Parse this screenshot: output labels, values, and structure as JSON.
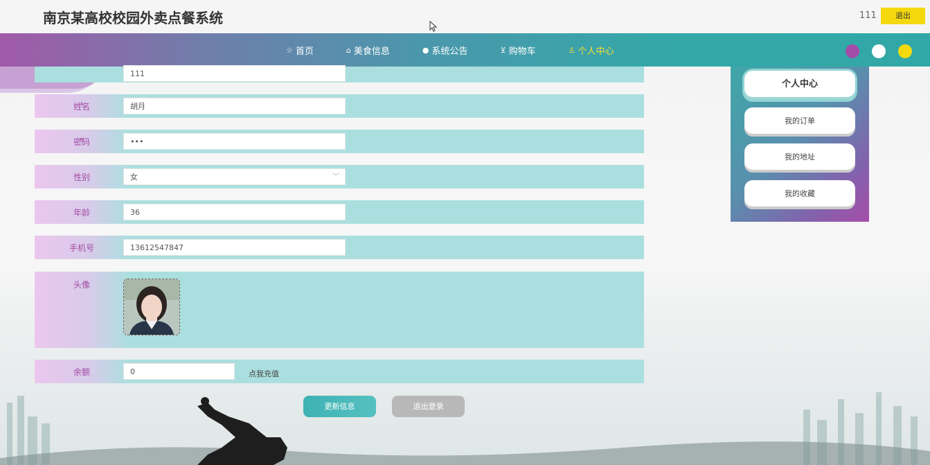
{
  "header": {
    "site_title": "南京某高校校园外卖点餐系统",
    "username": "111",
    "logout_label": "退出"
  },
  "nav": {
    "items": [
      {
        "icon": "star-icon",
        "glyph": "☆",
        "label": "首页"
      },
      {
        "icon": "bag-icon",
        "glyph": "⌂",
        "label": "美食信息"
      },
      {
        "icon": "info-icon",
        "glyph": "●",
        "label": "系统公告"
      },
      {
        "icon": "cart-icon",
        "glyph": "⊻",
        "label": "购物车"
      },
      {
        "icon": "user-icon",
        "glyph": "♙",
        "label": "个人中心"
      }
    ],
    "active_index": 4,
    "theme_dots": [
      "#a24ea8",
      "#ffffff",
      "#f5d90f"
    ]
  },
  "form": {
    "account_value": "111",
    "name_label": "姓名",
    "name_value": "胡月",
    "password_label": "密码",
    "password_value": "•••",
    "gender_label": "性别",
    "gender_value": "女",
    "age_label": "年龄",
    "age_value": "36",
    "phone_label": "手机号",
    "phone_value": "13612547847",
    "avatar_label": "头像",
    "balance_label": "余额",
    "balance_value": "0",
    "recharge_label": "点我充值",
    "update_button": "更新信息",
    "logout_button": "退出登录"
  },
  "side": {
    "title": "个人中心",
    "items": [
      "我的订单",
      "我的地址",
      "我的收藏"
    ]
  },
  "colors": {
    "accent": "#30a8a7",
    "purple": "#a44ca4",
    "active_nav": "#f5e03a",
    "yellow": "#f5d90f"
  }
}
